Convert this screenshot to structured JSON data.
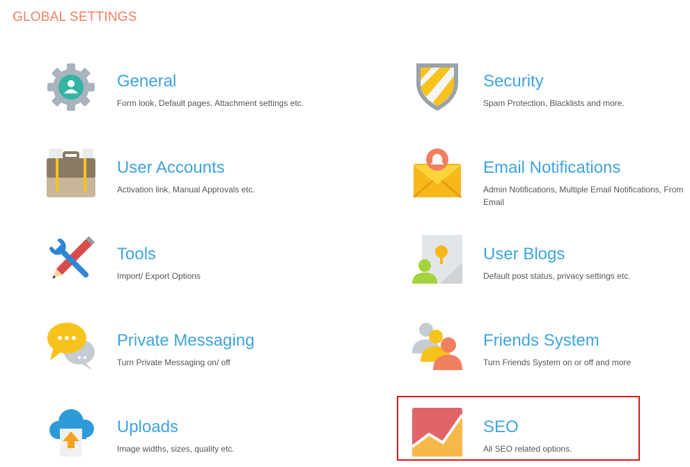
{
  "page": {
    "title": "GLOBAL SETTINGS"
  },
  "tiles": [
    {
      "title": "General",
      "description": "Form look, Default pages, Attachment settings etc.",
      "icon": "gear-user-icon"
    },
    {
      "title": "Security",
      "description": "Spam Protection, Blacklists and more.",
      "icon": "shield-icon"
    },
    {
      "title": "User Accounts",
      "description": "Activation link, Manual Approvals etc.",
      "icon": "briefcase-icon"
    },
    {
      "title": "Email Notifications",
      "description": "Admin Notifications, Multiple Email Notifications, From Email",
      "icon": "envelope-bell-icon"
    },
    {
      "title": "Tools",
      "description": "Import/ Export Options",
      "icon": "pencil-wrench-icon"
    },
    {
      "title": "User Blogs",
      "description": "Default post status, privacy settings etc.",
      "icon": "blog-image-icon"
    },
    {
      "title": "Private Messaging",
      "description": "Turn Private Messaging on/ off",
      "icon": "chat-bubbles-icon"
    },
    {
      "title": "Friends System",
      "description": "Turn Friends System on or off and more",
      "icon": "people-group-icon"
    },
    {
      "title": "Uploads",
      "description": "Image widths, sizes, quality etc.",
      "icon": "cloud-upload-icon"
    },
    {
      "title": "SEO",
      "description": "All SEO related options.",
      "icon": "seo-chart-icon",
      "highlighted": true
    }
  ],
  "colors": {
    "heading": "#f07f5f",
    "tile_title": "#3ea4dc",
    "description": "#555555",
    "highlight_border": "#d9171b"
  }
}
